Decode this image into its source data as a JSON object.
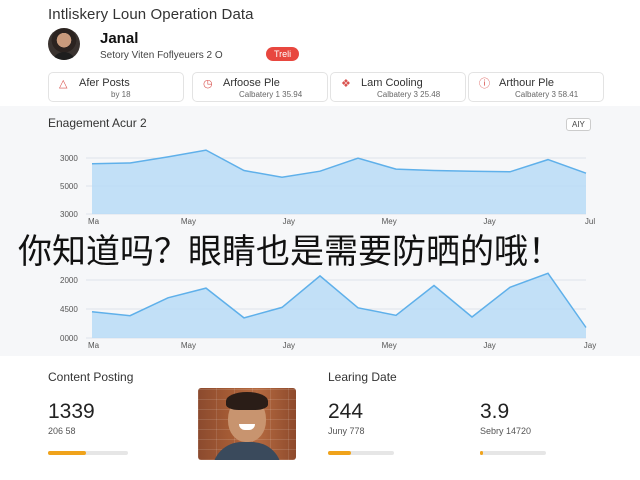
{
  "page": {
    "title": "Intliskery Loun Operation Data"
  },
  "profile": {
    "name": "Janal",
    "subtitle": "Setory Viten Foflyeuers 2 O",
    "badge": "Treli"
  },
  "metric_cards": [
    {
      "icon": "warning-triangle-icon",
      "label": "Afer Posts",
      "sub": "by 18"
    },
    {
      "icon": "clock-icon",
      "label": "Arfoose Ple",
      "sub": "Calbatery 1 35.94"
    },
    {
      "icon": "tag-icon",
      "label": "Lam Cooling",
      "sub": "Calbatery 3 25.48"
    },
    {
      "icon": "alert-circle-icon",
      "label": "Arthour Ple",
      "sub": "Calbatery 3 58.41"
    }
  ],
  "chart_header": {
    "title": "Enagement Acur 2",
    "filter_label": "AIY"
  },
  "chart_data": [
    {
      "type": "area",
      "title": "Enagement Acur 2",
      "y_tick_labels": [
        "3000",
        "5000",
        "3000"
      ],
      "x_tick_labels": [
        "Ma",
        "May",
        "Jay",
        "Mey",
        "Jay",
        "Jul"
      ],
      "series": [
        {
          "values": [
            3.7,
            3.75,
            4.2,
            4.7,
            3.2,
            2.7,
            3.15,
            4.1,
            3.3,
            3.2,
            3.15,
            3.1,
            4.0,
            3.0
          ]
        }
      ]
    },
    {
      "type": "area",
      "y_tick_labels": [
        "2000",
        "4500",
        "0000"
      ],
      "x_tick_labels": [
        "Ma",
        "May",
        "Jay",
        "Mey",
        "Jay",
        "Jay"
      ],
      "series": [
        {
          "values": [
            3.0,
            2.55,
            4.6,
            5.7,
            2.3,
            3.5,
            7.1,
            3.45,
            2.6,
            6.0,
            2.4,
            5.8,
            7.4,
            1.2
          ]
        }
      ]
    }
  ],
  "overlay_caption": "你知道吗？眼睛也是需要防晒的哦！",
  "stats": {
    "content_posting": {
      "label": "Content Posting",
      "value": "1339",
      "sub": "206 58",
      "progress": 0.48
    },
    "learning_date": {
      "label": "Learing Date",
      "value": "244",
      "sub": "Juny 778",
      "progress": 0.35
    },
    "third": {
      "value": "3.9",
      "sub": "Sebry 14720",
      "progress": 0.05
    }
  },
  "colors": {
    "accent_red": "#e8473f",
    "chart_fill": "#b9dcf7",
    "chart_line": "#5fb0ea",
    "progress": "#f0a31b"
  }
}
